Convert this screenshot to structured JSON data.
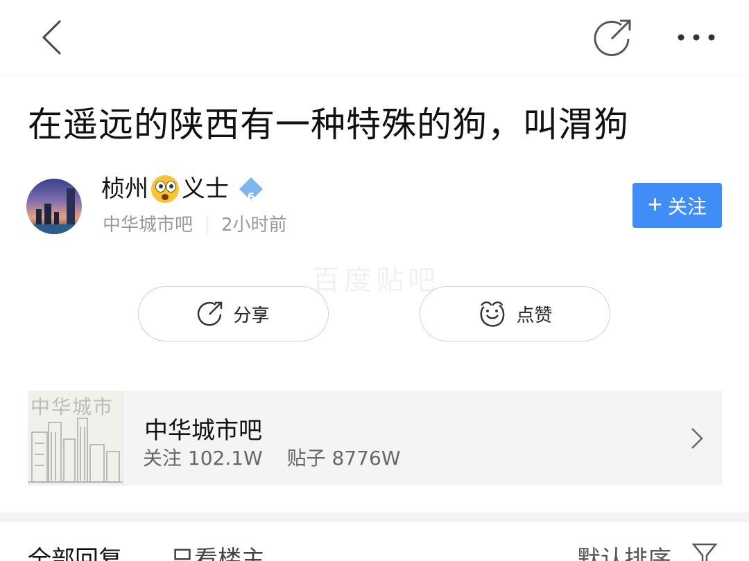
{
  "post": {
    "title": "在遥远的陕西有一种特殊的狗，叫渭狗"
  },
  "author": {
    "name_prefix": "桢州",
    "name_suffix": "义士",
    "level": "6",
    "forum": "中华城市吧",
    "time": "2小时前",
    "follow_label": "关注"
  },
  "watermark": "百度贴吧",
  "actions": {
    "share_label": "分享",
    "like_label": "点赞"
  },
  "forum_card": {
    "thumb_text": "中华城市",
    "name": "中华城市吧",
    "followers": "关注 102.1W",
    "posts": "贴子 8776W"
  },
  "tabs": {
    "all": "全部回复",
    "owner": "只看楼主",
    "sort": "默认排序"
  },
  "colors": {
    "accent": "#3f8df5",
    "level_badge": "#7fb6f0"
  }
}
